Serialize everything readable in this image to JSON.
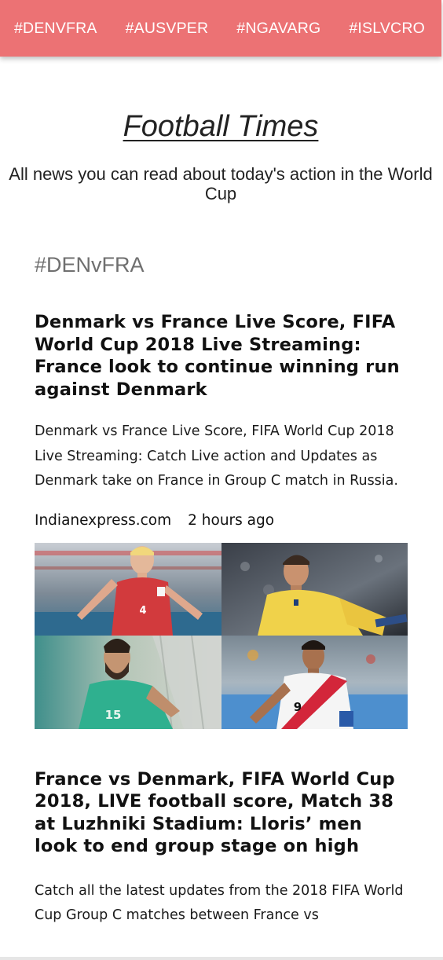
{
  "nav": {
    "items": [
      {
        "label": "#DENVFRA"
      },
      {
        "label": "#AUSVPER"
      },
      {
        "label": "#NGAVARG"
      },
      {
        "label": "#ISLVCRO"
      }
    ]
  },
  "header": {
    "title": "Football Times",
    "tagline": "All news you can read about today's action in the World Cup"
  },
  "section": {
    "tag": "#DENvFRA"
  },
  "articles": [
    {
      "title": "Denmark vs France Live Score, FIFA World Cup 2018 Live Streaming: France look to continue winning run against Denmark",
      "description": "Denmark vs France Live Score, FIFA World Cup 2018 Live Streaming: Catch Live action and Updates as Denmark take on France in Group C match in Russia.",
      "source": "Indianexpress.com",
      "time": "2 hours ago",
      "image": {
        "players": [
          {
            "number": "4"
          },
          {
            "number": ""
          },
          {
            "number": "15"
          },
          {
            "number": "9"
          }
        ]
      }
    },
    {
      "title": "France vs Denmark, FIFA World Cup 2018, LIVE football score, Match 38 at Luzhniki Stadium: Lloris’ men look to end group stage on high",
      "description": "Catch all the latest updates from the 2018 FIFA World Cup Group C matches between France vs"
    }
  ],
  "colors": {
    "nav_bg": "#ec7274",
    "section_tag": "#6f6f6f"
  }
}
